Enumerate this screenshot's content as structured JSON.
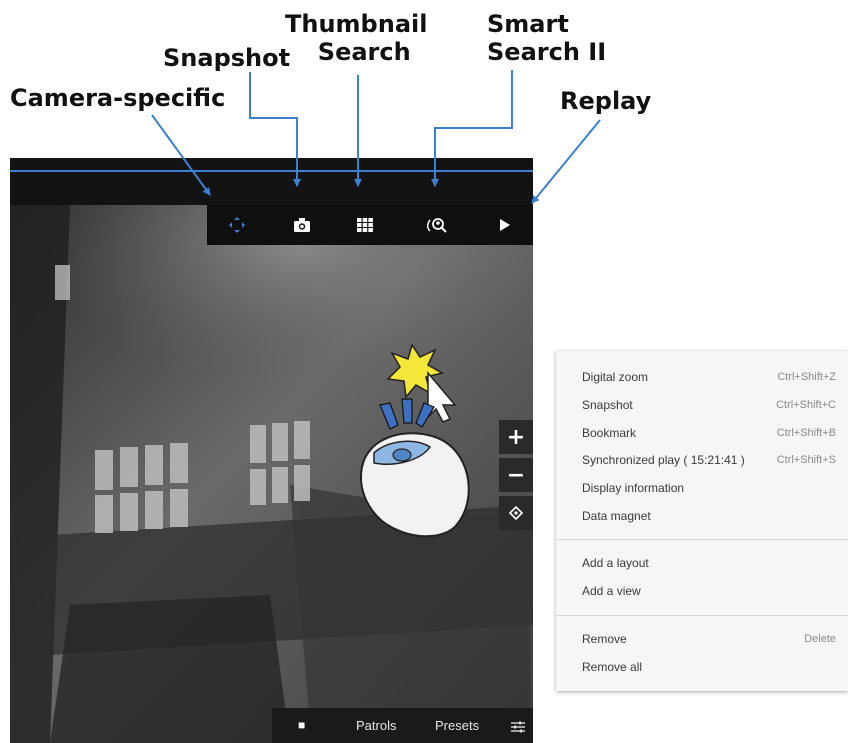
{
  "callouts": {
    "camera_specific": "Camera-specific",
    "snapshot": "Snapshot",
    "thumbnail_search": [
      "Thumbnail",
      "Search"
    ],
    "smart_search": [
      "Smart",
      "Search II"
    ],
    "replay": "Replay"
  },
  "toolbar": {
    "buttons": [
      "camera-specific",
      "snapshot",
      "thumbnail-search",
      "smart-search-ii",
      "replay"
    ]
  },
  "zoom_controls": {
    "zoom_in": "+",
    "zoom_out": "−"
  },
  "bottom_bar": {
    "stop": "■",
    "patrols": "Patrols",
    "presets": "Presets"
  },
  "context_menu": {
    "items": [
      {
        "label": "Digital zoom",
        "shortcut": "Ctrl+Shift+Z"
      },
      {
        "label": "Snapshot",
        "shortcut": "Ctrl+Shift+C"
      },
      {
        "label": "Bookmark",
        "shortcut": "Ctrl+Shift+B"
      },
      {
        "label": "Synchronized play ( 15:21:41 )",
        "shortcut": "Ctrl+Shift+S"
      },
      {
        "label": "Display information",
        "submenu": "›"
      },
      {
        "label": "Data magnet",
        "submenu": "›"
      },
      {
        "label": "Add a layout"
      },
      {
        "label": "Add a view"
      },
      {
        "label": "Remove",
        "shortcut": "Delete"
      },
      {
        "label": "Remove all"
      }
    ]
  },
  "colors": {
    "accent_blue": "#3d7fd0",
    "toolbar_bg": "#0f0f0f",
    "menu_bg": "#f6f6f6"
  }
}
